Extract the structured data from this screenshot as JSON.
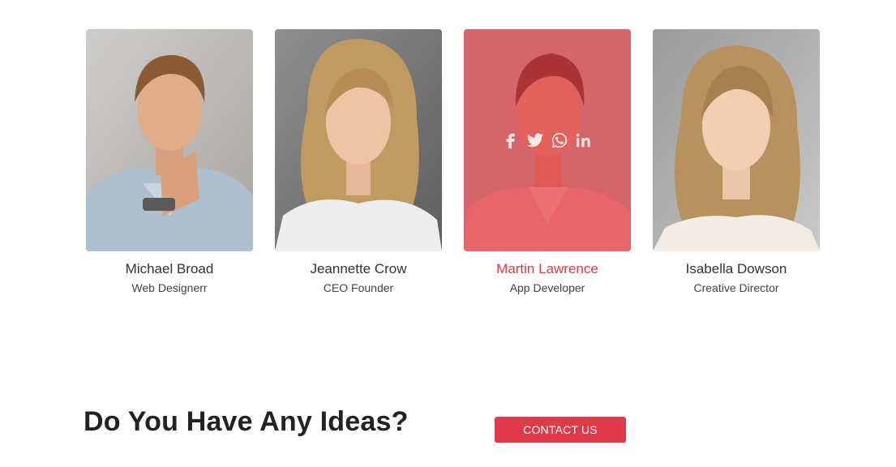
{
  "team": {
    "members": [
      {
        "name": "Michael Broad",
        "role": "Web Designerr"
      },
      {
        "name": "Jeannette Crow",
        "role": "CEO Founder"
      },
      {
        "name": "Martin Lawrence",
        "role": "App Developer"
      },
      {
        "name": "Isabella Dowson",
        "role": "Creative Director"
      }
    ],
    "highlight_color": "#e03a44",
    "social_icons": [
      "facebook-icon",
      "twitter-icon",
      "whatsapp-icon",
      "linkedin-icon"
    ]
  },
  "cta": {
    "heading": "Do You Have Any Ideas?",
    "button_label": "CONTACT US",
    "button_color": "#e03a4a"
  }
}
